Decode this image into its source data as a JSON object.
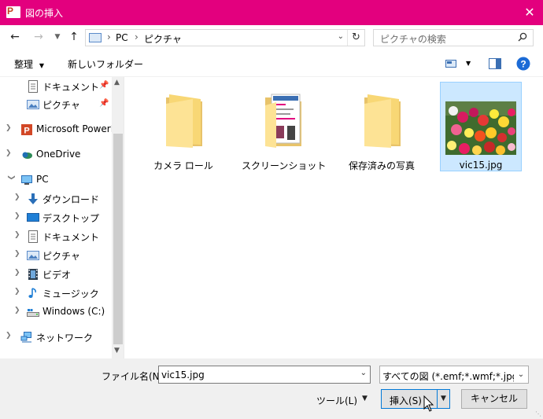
{
  "window": {
    "title": "図の挿入",
    "close_symbol": "✕"
  },
  "nav": {
    "breadcrumb": [
      "PC",
      "ピクチャ"
    ],
    "search_placeholder": "ピクチャの検索"
  },
  "toolbar": {
    "organize_label": "整理",
    "new_folder_label": "新しいフォルダー"
  },
  "sidebar": {
    "items": [
      {
        "label": "ドキュメント",
        "icon": "document-icon",
        "pinned": true
      },
      {
        "label": "ピクチャ",
        "icon": "pictures-icon",
        "pinned": true
      },
      {
        "label": "Microsoft PowerP",
        "icon": "powerpoint-icon"
      },
      {
        "label": "OneDrive",
        "icon": "onedrive-icon"
      },
      {
        "label": "PC",
        "icon": "pc-icon"
      },
      {
        "label": "ダウンロード",
        "icon": "download-icon"
      },
      {
        "label": "デスクトップ",
        "icon": "desktop-icon"
      },
      {
        "label": "ドキュメント",
        "icon": "document-icon"
      },
      {
        "label": "ピクチャ",
        "icon": "pictures-icon"
      },
      {
        "label": "ビデオ",
        "icon": "video-icon"
      },
      {
        "label": "ミュージック",
        "icon": "music-icon"
      },
      {
        "label": "Windows (C:)",
        "icon": "drive-icon"
      },
      {
        "label": "ネットワーク",
        "icon": "network-icon"
      }
    ]
  },
  "content": {
    "items": [
      {
        "label": "カメラ ロール",
        "type": "folder"
      },
      {
        "label": "スクリーンショット",
        "type": "folder"
      },
      {
        "label": "保存済みの写真",
        "type": "folder"
      },
      {
        "label": "vic15.jpg",
        "type": "image",
        "selected": true
      }
    ]
  },
  "footer": {
    "filename_label": "ファイル名(N):",
    "filename_value": "vic15.jpg",
    "filter_value": "すべての図 (*.emf;*.wmf;*.jpg;*.jp",
    "tools_label": "ツール(L)",
    "insert_label": "挿入(S)",
    "cancel_label": "キャンセル"
  },
  "colors": {
    "titlebar": "#e3007e",
    "selection": "#cce8ff",
    "accent": "#0078d7"
  }
}
